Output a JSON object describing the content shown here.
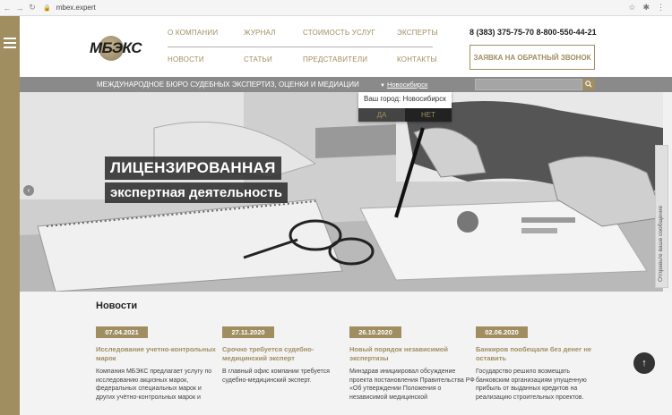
{
  "browser": {
    "url": "mbex.expert"
  },
  "header": {
    "logo_text": "МБЭКС",
    "menu": [
      "О КОМПАНИИ",
      "ЖУРНАЛ",
      "СТОИМОСТЬ УСЛУГ",
      "ЭКСПЕРТЫ",
      "НОВОСТИ",
      "СТАТЬИ",
      "ПРЕДСТАВИТЕЛИ",
      "КОНТАКТЫ"
    ],
    "phones": "8 (383) 375-75-70  8-800-550-44-21",
    "callback_label": "ЗАЯВКА НА ОБРАТНЫЙ ЗВОНОК"
  },
  "strip": {
    "text": "МЕЖДУНАРОДНОЕ БЮРО СУДЕБНЫХ ЭКСПЕРТИЗ, ОЦЕНКИ И МЕДИАЦИИ",
    "city": "Новосибирск"
  },
  "city_popup": {
    "question": "Ваш город: Новосибирск",
    "yes": "ДА",
    "no": "НЕТ"
  },
  "hero": {
    "title_line1": "ЛИЦЕНЗИРОВАННАЯ",
    "title_line2": "экспертная деятельность"
  },
  "side_tab": {
    "label": "Отправьте ваше сообщение"
  },
  "news": {
    "title": "Новости",
    "items": [
      {
        "date": "07.04.2021",
        "headline": "Исследование учетно-контрольных марок",
        "body": "Компания МБЭКС предлагает услугу по исследованию акцизных марок, федеральных специальных марок и других учётно-контрольных марок и"
      },
      {
        "date": "27.11.2020",
        "headline": "Срочно требуется судебно-медицинский эксперт",
        "body": "В главный офис компании требуется судебно-медицинский эксперт."
      },
      {
        "date": "26.10.2020",
        "headline": "Новый порядок независимой экспертизы",
        "body": "Минздрав инициировал обсуждение проекта постановления Правительства РФ «Об утверждении Положения о независимой медицинской"
      },
      {
        "date": "02.06.2020",
        "headline": "Банкиров пообещали без денег не оставить",
        "body": "Государство решило возмещать банковским организациям упущенную прибыль от выданных кредитов на реализацию строительных проектов."
      }
    ]
  }
}
